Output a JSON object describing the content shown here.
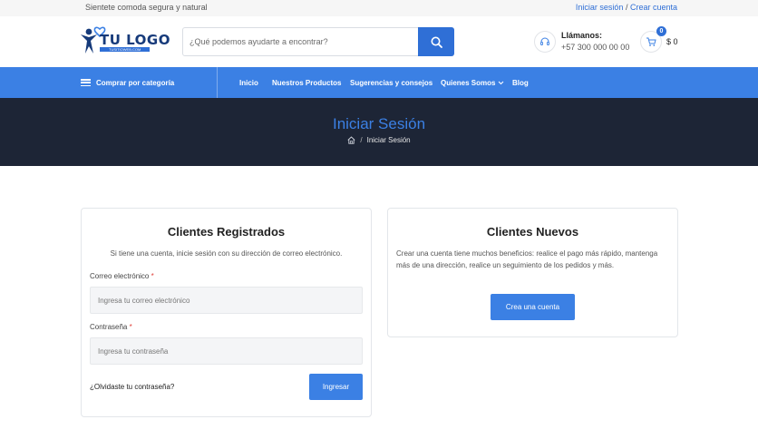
{
  "topbar": {
    "tagline": "Sientete comoda segura y natural",
    "login_link": "Iniciar sesión",
    "separator": "/",
    "register_link": "Crear cuenta"
  },
  "logo": {
    "text": "TU LOGO",
    "subtext": "TUSITIOWEB.COM"
  },
  "search": {
    "placeholder": "¿Qué podemos ayudarte a encontrar?",
    "icon": "search-icon"
  },
  "contact": {
    "label": "Llámanos:",
    "phone": "+57 300 000 00 00",
    "icon": "headset-icon"
  },
  "cart": {
    "count": "0",
    "total": "$ 0",
    "icon": "cart-icon"
  },
  "nav": {
    "category_label": "Comprar por categoría",
    "items": [
      {
        "label": "Inicio"
      },
      {
        "label": "Nuestros Productos"
      },
      {
        "label": "Sugerencias y consejos"
      },
      {
        "label": "Quienes Somos"
      },
      {
        "label": "Blog"
      }
    ]
  },
  "hero": {
    "title": "Iniciar Sesión",
    "breadcrumb_separator": "/",
    "breadcrumb_current": "Iniciar Sesión"
  },
  "login": {
    "title": "Clientes Registrados",
    "description": "Si tiene una cuenta, inicie sesión con su dirección de correo electrónico.",
    "email_label": "Correo electrónico",
    "email_placeholder": "Ingresa tu correo electrónico",
    "password_label": "Contraseña",
    "password_placeholder": "Ingresa tu contraseña",
    "required_mark": "*",
    "forgot_link": "¿Olvidaste tu contraseña?",
    "submit_label": "Ingresar"
  },
  "register": {
    "title": "Clientes Nuevos",
    "description": "Crear una cuenta tiene muchos beneficios: realice el pago más rápido, mantenga más de una dirección, realice un seguimiento de los pedidos y más.",
    "button_label": "Crea una cuenta"
  },
  "colors": {
    "accent": "#3b80e4",
    "hero_bg": "#1d2536",
    "required": "#e0403a"
  }
}
